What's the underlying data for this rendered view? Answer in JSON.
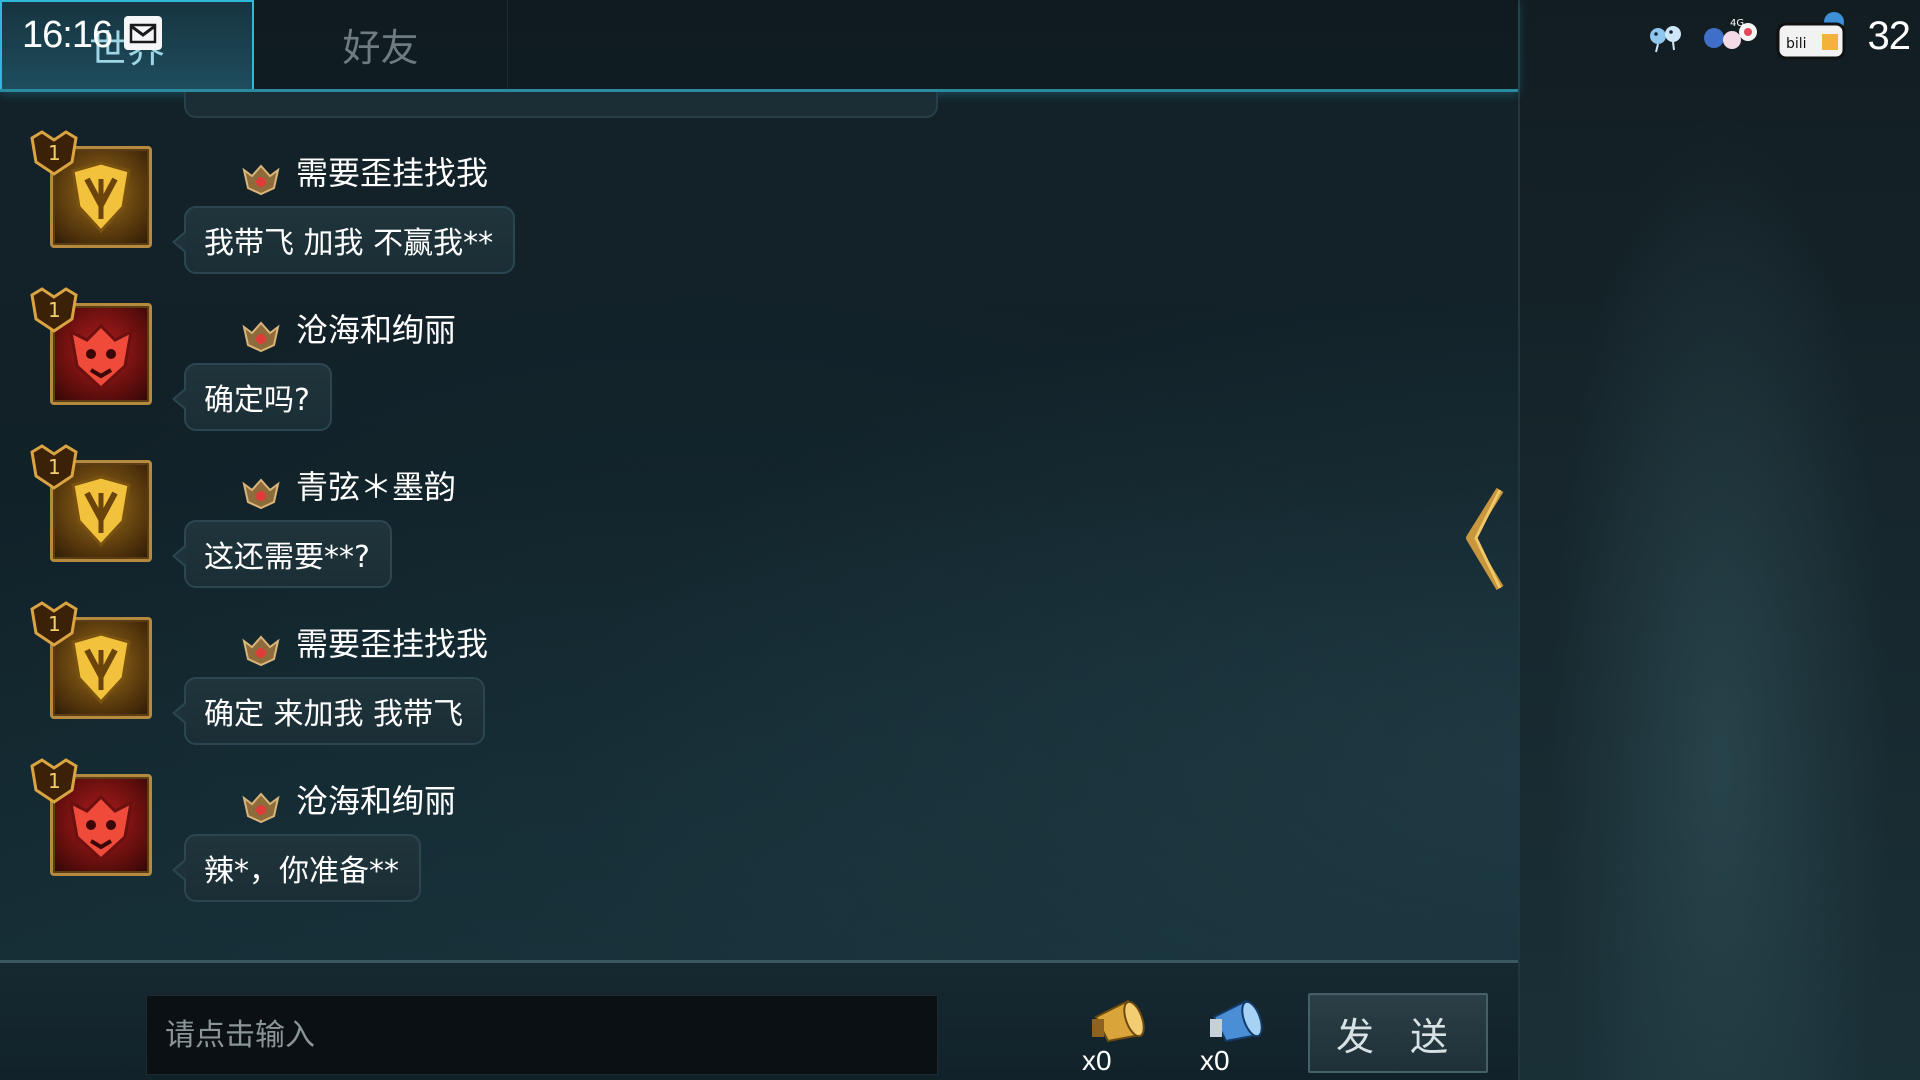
{
  "status_bar": {
    "time": "16:16",
    "battery_level": "32",
    "icons": [
      "mail-icon",
      "bird-sticker-icon",
      "4g-anime-sticker-icon",
      "bilibili-tv-icon"
    ]
  },
  "tabs": [
    {
      "label": "世界",
      "active": true
    },
    {
      "label": "好友",
      "active": false
    }
  ],
  "messages": [
    {
      "sender": "需要歪挂找我",
      "text": "我带飞 加我 不赢我**",
      "avatar": "gold-shield-emblem",
      "rank": "1"
    },
    {
      "sender": "沧海和绚丽",
      "text": "确定吗?",
      "avatar": "red-beast-emblem",
      "rank": "1"
    },
    {
      "sender": "青弦＊墨韵",
      "text": "这还需要**?",
      "avatar": "gold-shield-emblem",
      "rank": "1"
    },
    {
      "sender": "需要歪挂找我",
      "text": "确定 来加我 我带飞",
      "avatar": "gold-shield-emblem",
      "rank": "1"
    },
    {
      "sender": "沧海和绚丽",
      "text": "辣*，你准备**",
      "avatar": "red-beast-emblem",
      "rank": "1"
    }
  ],
  "input": {
    "placeholder": "请点击输入",
    "value": ""
  },
  "horns": [
    {
      "name": "gold-horn-icon",
      "count": "x0",
      "color": "#d9a43a"
    },
    {
      "name": "blue-horn-icon",
      "count": "x0",
      "color": "#4a8fd6"
    }
  ],
  "send_label": "发 送",
  "colors": {
    "accent": "#2fb8d8",
    "gold": "#c8963c",
    "panel": "#1b2e36"
  }
}
